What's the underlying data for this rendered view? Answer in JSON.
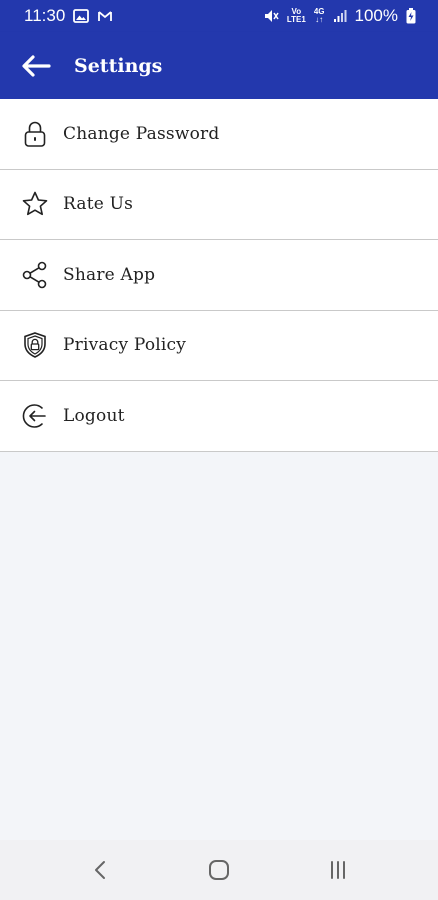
{
  "status_bar": {
    "time": "11:30",
    "battery": "100%",
    "network_volte": "Vó\nLTE1",
    "network_4g": "4G"
  },
  "app_bar": {
    "title": "Settings",
    "back_icon": "arrow-left-icon"
  },
  "menu": {
    "items": [
      {
        "label": "Change Password",
        "icon": "lock-icon"
      },
      {
        "label": "Rate Us",
        "icon": "star-icon"
      },
      {
        "label": "Share App",
        "icon": "share-icon"
      },
      {
        "label": "Privacy Policy",
        "icon": "shield-icon"
      },
      {
        "label": "Logout",
        "icon": "logout-icon"
      }
    ]
  },
  "nav_bar": {
    "back_icon": "back-chevron-icon",
    "home_icon": "home-icon",
    "recents_icon": "recents-icon"
  },
  "colors": {
    "primary": "#2338ad",
    "background": "#f3f5f9",
    "divider": "#c9c9c9",
    "text": "#222222"
  }
}
